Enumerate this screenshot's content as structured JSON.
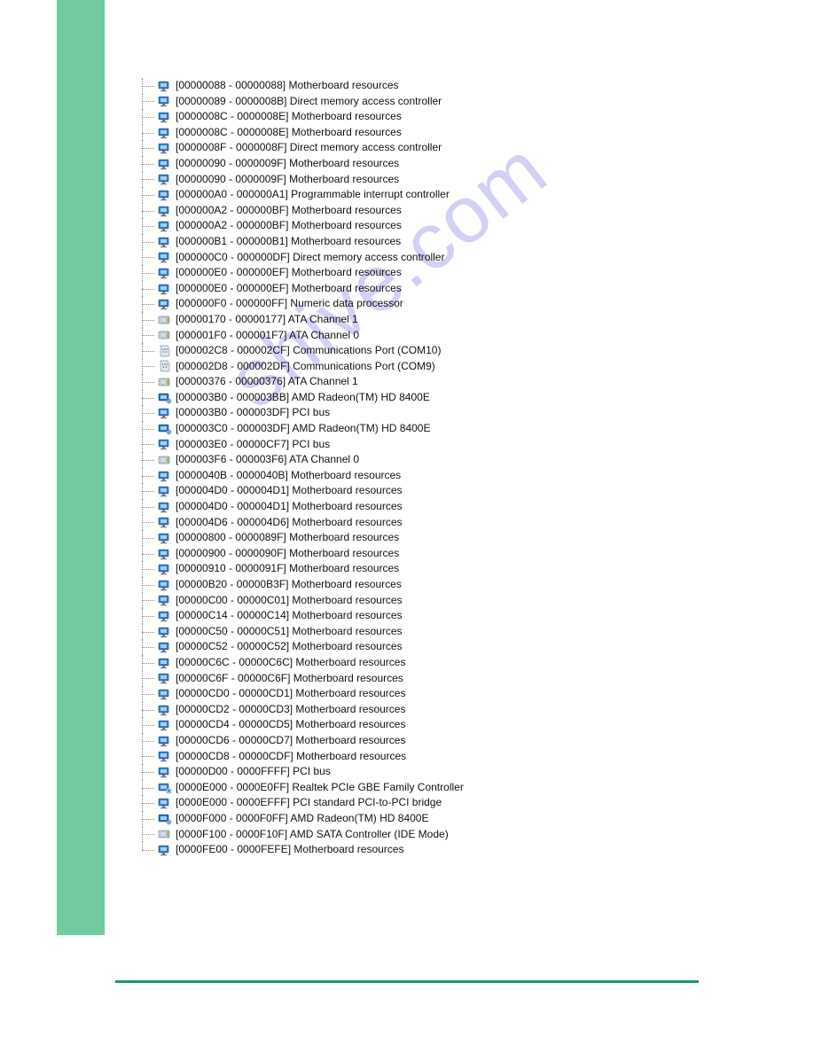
{
  "watermark": "shive.com",
  "rows": [
    {
      "icon": "sys",
      "text": "[00000088 - 00000088]  Motherboard resources"
    },
    {
      "icon": "sys",
      "text": "[00000089 - 0000008B]  Direct memory access controller"
    },
    {
      "icon": "sys",
      "text": "[0000008C - 0000008E]  Motherboard resources"
    },
    {
      "icon": "sys",
      "text": "[0000008C - 0000008E]  Motherboard resources"
    },
    {
      "icon": "sys",
      "text": "[0000008F - 0000008F]  Direct memory access controller"
    },
    {
      "icon": "sys",
      "text": "[00000090 - 0000009F]  Motherboard resources"
    },
    {
      "icon": "sys",
      "text": "[00000090 - 0000009F]  Motherboard resources"
    },
    {
      "icon": "sys",
      "text": "[000000A0 - 000000A1]  Programmable interrupt controller"
    },
    {
      "icon": "sys",
      "text": "[000000A2 - 000000BF]  Motherboard resources"
    },
    {
      "icon": "sys",
      "text": "[000000A2 - 000000BF]  Motherboard resources"
    },
    {
      "icon": "sys",
      "text": "[000000B1 - 000000B1]  Motherboard resources"
    },
    {
      "icon": "sys",
      "text": "[000000C0 - 000000DF]  Direct memory access controller"
    },
    {
      "icon": "sys",
      "text": "[000000E0 - 000000EF]  Motherboard resources"
    },
    {
      "icon": "sys",
      "text": "[000000E0 - 000000EF]  Motherboard resources"
    },
    {
      "icon": "sys",
      "text": "[000000F0 - 000000FF]  Numeric data processor"
    },
    {
      "icon": "disk",
      "text": "[00000170 - 00000177]  ATA Channel 1"
    },
    {
      "icon": "disk",
      "text": "[000001F0 - 000001F7]  ATA Channel 0"
    },
    {
      "icon": "port",
      "text": "[000002C8 - 000002CF]  Communications Port (COM10)"
    },
    {
      "icon": "port",
      "text": "[000002D8 - 000002DF]  Communications Port (COM9)"
    },
    {
      "icon": "disk",
      "text": "[00000376 - 00000376]  ATA Channel 1"
    },
    {
      "icon": "gpu",
      "text": "[000003B0 - 000003BB]  AMD Radeon(TM) HD 8400E"
    },
    {
      "icon": "sys",
      "text": "[000003B0 - 000003DF]  PCI bus"
    },
    {
      "icon": "gpu",
      "text": "[000003C0 - 000003DF]  AMD Radeon(TM) HD 8400E"
    },
    {
      "icon": "sys",
      "text": "[000003E0 - 00000CF7]  PCI bus"
    },
    {
      "icon": "disk",
      "text": "[000003F6 - 000003F6]  ATA Channel 0"
    },
    {
      "icon": "sys",
      "text": "[0000040B - 0000040B]  Motherboard resources"
    },
    {
      "icon": "sys",
      "text": "[000004D0 - 000004D1]  Motherboard resources"
    },
    {
      "icon": "sys",
      "text": "[000004D0 - 000004D1]  Motherboard resources"
    },
    {
      "icon": "sys",
      "text": "[000004D6 - 000004D6]  Motherboard resources"
    },
    {
      "icon": "sys",
      "text": "[00000800 - 0000089F]  Motherboard resources"
    },
    {
      "icon": "sys",
      "text": "[00000900 - 0000090F]  Motherboard resources"
    },
    {
      "icon": "sys",
      "text": "[00000910 - 0000091F]  Motherboard resources"
    },
    {
      "icon": "sys",
      "text": "[00000B20 - 00000B3F]  Motherboard resources"
    },
    {
      "icon": "sys",
      "text": "[00000C00 - 00000C01]  Motherboard resources"
    },
    {
      "icon": "sys",
      "text": "[00000C14 - 00000C14]  Motherboard resources"
    },
    {
      "icon": "sys",
      "text": "[00000C50 - 00000C51]  Motherboard resources"
    },
    {
      "icon": "sys",
      "text": "[00000C52 - 00000C52]  Motherboard resources"
    },
    {
      "icon": "sys",
      "text": "[00000C6C - 00000C6C]  Motherboard resources"
    },
    {
      "icon": "sys",
      "text": "[00000C6F - 00000C6F]  Motherboard resources"
    },
    {
      "icon": "sys",
      "text": "[00000CD0 - 00000CD1]  Motherboard resources"
    },
    {
      "icon": "sys",
      "text": "[00000CD2 - 00000CD3]  Motherboard resources"
    },
    {
      "icon": "sys",
      "text": "[00000CD4 - 00000CD5]  Motherboard resources"
    },
    {
      "icon": "sys",
      "text": "[00000CD6 - 00000CD7]  Motherboard resources"
    },
    {
      "icon": "sys",
      "text": "[00000CD8 - 00000CDF]  Motherboard resources"
    },
    {
      "icon": "sys",
      "text": "[00000D00 - 0000FFFF]  PCI bus"
    },
    {
      "icon": "net",
      "text": "[0000E000 - 0000E0FF]  Realtek PCIe GBE Family Controller"
    },
    {
      "icon": "sys",
      "text": "[0000E000 - 0000EFFF]  PCI standard PCI-to-PCI bridge"
    },
    {
      "icon": "gpu",
      "text": "[0000F000 - 0000F0FF]  AMD Radeon(TM) HD 8400E"
    },
    {
      "icon": "disk",
      "text": "[0000F100 - 0000F10F]  AMD SATA Controller (IDE Mode)"
    },
    {
      "icon": "sys",
      "text": "[0000FE00 - 0000FEFE]  Motherboard resources"
    }
  ]
}
